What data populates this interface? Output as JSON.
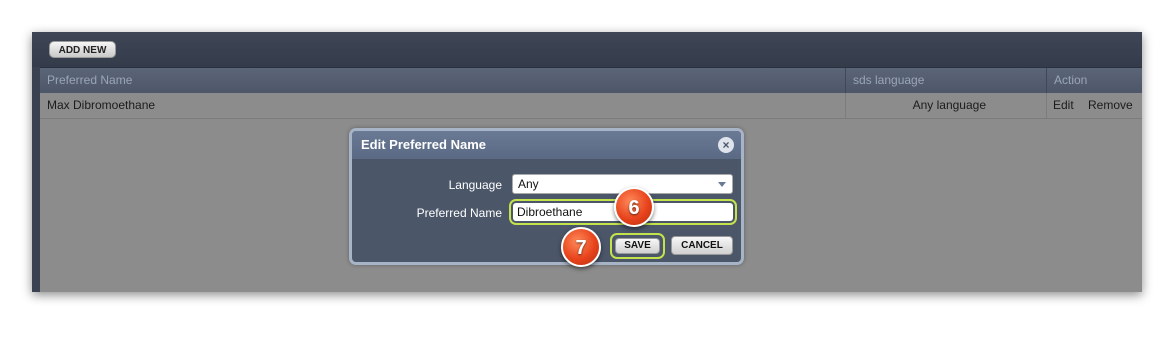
{
  "toolbar": {
    "add_new_label": "ADD NEW"
  },
  "table": {
    "headers": [
      "Preferred Name",
      "sds language",
      "Action"
    ],
    "rows": [
      {
        "name": "Max Dibromoethane",
        "language": "Any language",
        "actions": [
          "Edit",
          "Remove"
        ]
      }
    ]
  },
  "dialog": {
    "title": "Edit Preferred Name",
    "close_icon": "×",
    "language_label": "Language",
    "language_value": "Any",
    "preferred_name_label": "Preferred Name",
    "preferred_name_value": "Dibroethane",
    "save_label": "SAVE",
    "cancel_label": "CANCEL"
  },
  "annotations": {
    "step6": "6",
    "step7": "7"
  },
  "colors": {
    "highlight": "#c3e24b",
    "badge": "#e8431c",
    "dialog_bg": "#4b5669"
  }
}
